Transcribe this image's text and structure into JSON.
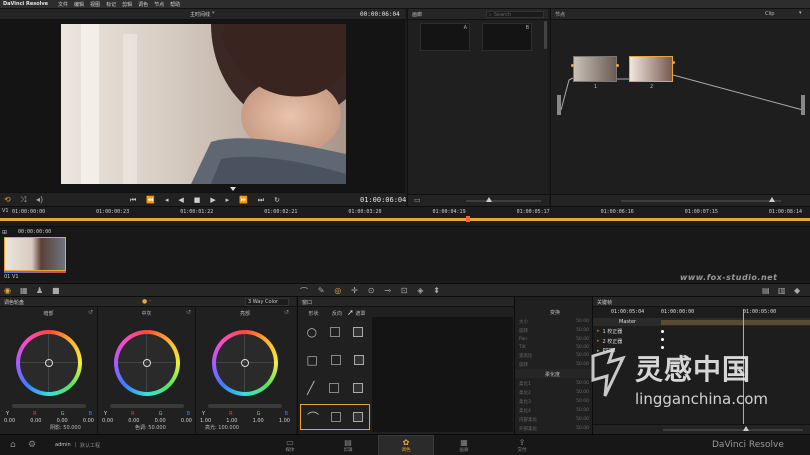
{
  "menubar": {
    "app_name": "DaVinci Resolve",
    "items": [
      "文件",
      "编辑",
      "视图",
      "标记",
      "剪辑",
      "调色",
      "节点",
      "帮助"
    ]
  },
  "viewer": {
    "timeline_name": "主时间线",
    "timecode_top": "00:00:06:04",
    "timecode_bottom": "01:00:06:04"
  },
  "gallery": {
    "title": "画廊",
    "search_placeholder": "Search",
    "stills": [
      "A",
      "B"
    ]
  },
  "node_editor": {
    "title": "节点",
    "mode": "Clip",
    "nodes": [
      "1",
      "2"
    ]
  },
  "timeline": {
    "track": "V1",
    "ticks": [
      "01:00:00:00",
      "01:00:00:23",
      "01:00:01:22",
      "01:00:02:21",
      "01:00:03:20",
      "01:00:04:19",
      "01:00:05:17",
      "01:00:06:16",
      "01:00:07:15",
      "01:00:08:14"
    ]
  },
  "clips": {
    "clip_timecode": "00:00:00:00",
    "clip_label": "01  V1",
    "watermark": "www.fox-studio.net"
  },
  "color_wheels": {
    "title": "调色轮盘",
    "mode": "3 Way Color",
    "wheels": [
      {
        "title": "暗部",
        "labels": [
          "Y",
          "R",
          "G",
          "B"
        ],
        "values": [
          "0.00",
          "0.00",
          "0.00",
          "0.00"
        ],
        "footer": "阴影: 50.000"
      },
      {
        "title": "中灰",
        "labels": [
          "Y",
          "R",
          "G",
          "B"
        ],
        "values": [
          "0.00",
          "0.00",
          "0.00",
          "0.00"
        ],
        "footer": "色调: 50.000"
      },
      {
        "title": "亮部",
        "labels": [
          "Y",
          "R",
          "G",
          "B"
        ],
        "values": [
          "1.00",
          "1.00",
          "1.00",
          "1.00"
        ],
        "footer": "高光: 100.000"
      }
    ]
  },
  "window_panel": {
    "title": "窗口",
    "tabs": [
      "形状",
      "反向",
      "遮罩"
    ]
  },
  "transform_panel": {
    "title": "变换",
    "fields": [
      "大小",
      "旋转",
      "Pan",
      "Tilt",
      "宽高比",
      "旋转"
    ],
    "values": [
      "50.00",
      "50.00",
      "50.00",
      "50.00",
      "50.00",
      "50.00"
    ],
    "softness_title": "柔化度",
    "softness_fields": [
      "柔化1",
      "柔化2",
      "柔化3",
      "柔化4",
      "内部柔化",
      "外部柔化"
    ],
    "softness_values": [
      "50.00",
      "50.00",
      "50.00",
      "50.00",
      "50.00",
      "50.00"
    ]
  },
  "keyframes": {
    "title": "关键帧",
    "tc_start": "01:00:05:04",
    "tc_mid": "01:00:00:00",
    "tc_end": "01:00:05:00",
    "master": "Master",
    "tracks": [
      "1  校正器",
      "2  校正器",
      "PTZR"
    ]
  },
  "bottom_bar": {
    "user": "admin",
    "project": "默认工程",
    "modules": [
      "媒体",
      "剪辑",
      "调色",
      "画廊",
      "交付"
    ],
    "active_module": "调色",
    "brand": "DaVinci Resolve"
  },
  "colors": {
    "accent": "#e9a43a",
    "wheel_ring": "#e34a3a",
    "active_module": "#2b2b2b"
  },
  "overlay_watermark": {
    "site": "lingganchina.com",
    "name": "灵感中国"
  }
}
